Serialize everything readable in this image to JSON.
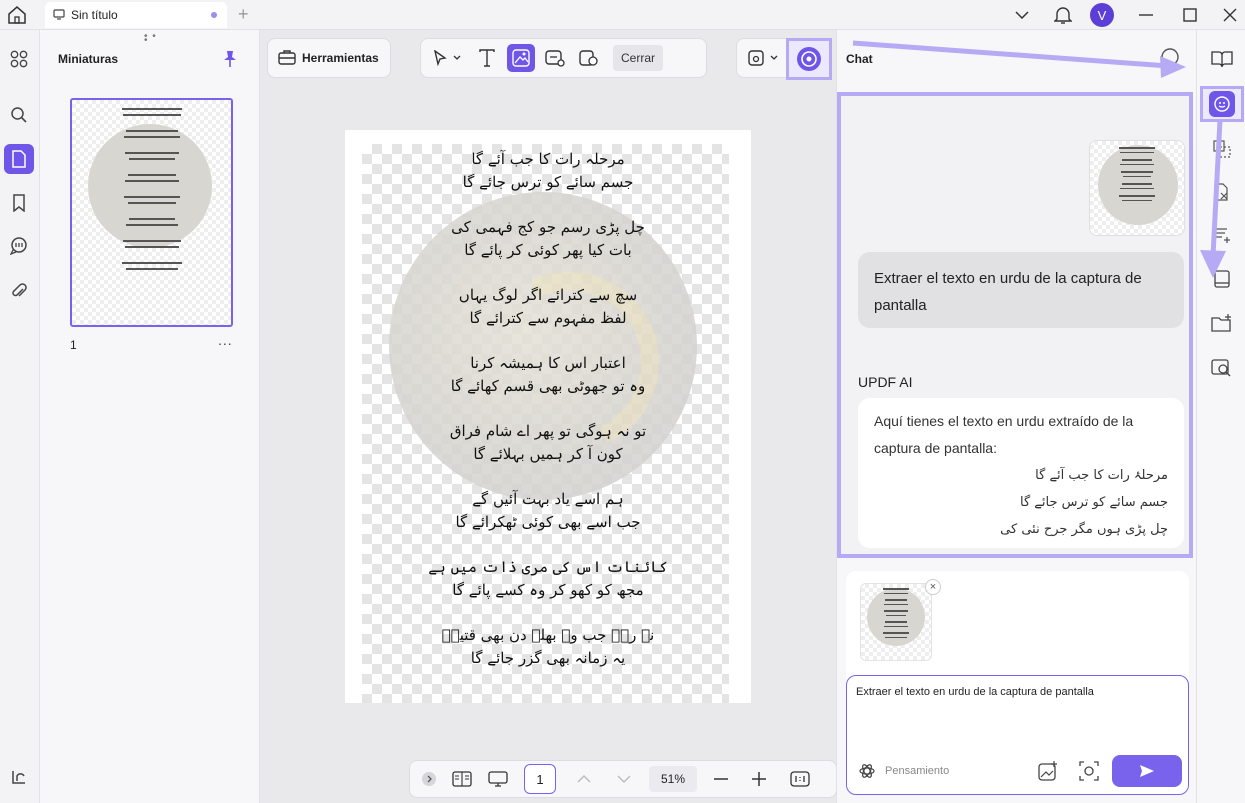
{
  "titlebar": {
    "tab_label": "Sin título",
    "avatar_initial": "V"
  },
  "thumbnails": {
    "title": "Miniaturas",
    "page_number": "1",
    "more": "..."
  },
  "toolbar": {
    "tools_label": "Herramientas",
    "close_label": "Cerrar"
  },
  "document": {
    "stanzas": [
      [
        "مرحلہ رات کا جب آئے گا",
        "جسم سائے کو ترس جائے گا"
      ],
      [
        "چل پڑی رسم جو کج فہمی کی",
        "بات کیا پھر کوئی کر پائے گا"
      ],
      [
        "سچ سے کترائے اگر لوگ یہاں",
        "لفظ مفہوم سے کترائے گا"
      ],
      [
        "اعتبار اس کا ہمیشہ کرنا",
        "وہ تو جھوٹی بھی قسم کھائے گا"
      ],
      [
        "تو نہ ہوگی تو پھر اے شام فراق",
        "کون آ کر ہمیں بہلائے گا"
      ],
      [
        "ہم اسے یاد بہت آئیں گے",
        "جب اسے بھی کوئی ٹھکرائے گا"
      ],
      [
        "کائنات اس کی مری ذات میں ہے",
        "مجھ کو کھو کر وہ کسے پائے گا"
      ],
      [
        "نہ رہے جب وہ بھلے دن بھی قتیلؔ",
        "یہ زمانہ بھی گزر جائے گا"
      ]
    ]
  },
  "bottombar": {
    "page_value": "1",
    "zoom": "51%"
  },
  "chat": {
    "title": "Chat",
    "user_message": "Extraer el texto en urdu de la captura de pantalla",
    "ai_name": "UPDF AI",
    "ai_intro": "Aquí tienes el texto en urdu extraído de la captura de pantalla:",
    "ai_lines": [
      "مرحلۂ رات کا جب آئے گا",
      "جسم سائے کو ترس جائے گا",
      "چل پڑی ہوں مگر جرح نئی کی"
    ],
    "attach_close": "×",
    "prompt_value": "Extraer el texto en urdu de la captura de pantalla",
    "thinking_label": "Pensamiento"
  },
  "colors": {
    "accent": "#6f56e8",
    "highlight": "#b6aaf5"
  }
}
